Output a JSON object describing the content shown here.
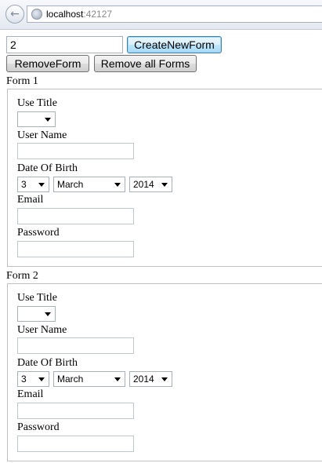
{
  "browser": {
    "host": "localhost",
    "port": ":42127"
  },
  "toolbar": {
    "count_value": "2",
    "create_label": "CreateNewForm",
    "remove_label": "RemoveForm",
    "remove_all_label": "Remove all Forms"
  },
  "forms": [
    {
      "title": "Form 1",
      "use_title_label": "Use Title",
      "use_title_value": "",
      "user_name_label": "User Name",
      "dob_label": "Date Of Birth",
      "dob_day": "3",
      "dob_month": "March",
      "dob_year": "2014",
      "email_label": "Email",
      "password_label": "Password"
    },
    {
      "title": "Form 2",
      "use_title_label": "Use Title",
      "use_title_value": "",
      "user_name_label": "User Name",
      "dob_label": "Date Of Birth",
      "dob_day": "3",
      "dob_month": "March",
      "dob_year": "2014",
      "email_label": "Email",
      "password_label": "Password"
    }
  ]
}
